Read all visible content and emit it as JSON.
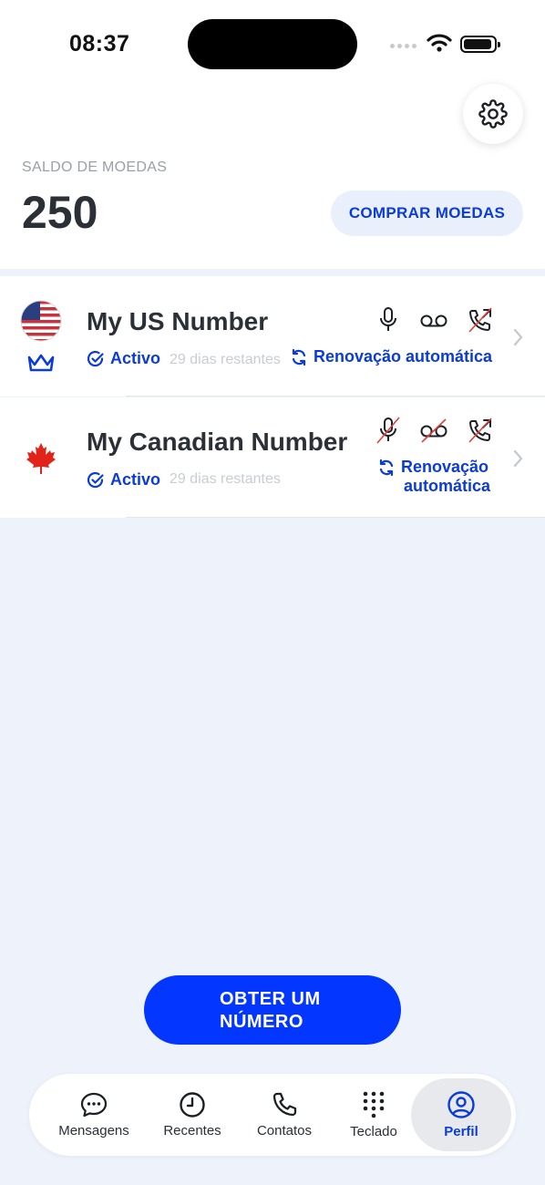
{
  "status": {
    "time": "08:37"
  },
  "balance": {
    "label": "SALDO DE MOEDAS",
    "value": "250",
    "buy_label": "COMPRAR MOEDAS"
  },
  "numbers": [
    {
      "name": "My US Number",
      "status": "Activo",
      "days": "29 dias restantes",
      "renewal": "Renovação automática",
      "flag": "us-flag",
      "premium_icon": "crown-icon",
      "features": {
        "voice": true,
        "voicemail": true,
        "forwarding": false
      }
    },
    {
      "name": "My Canadian Number",
      "status": "Activo",
      "days": "29 dias restantes",
      "renewal_line1": "Renovação",
      "renewal_line2": "automática",
      "flag": "canada-flag",
      "features": {
        "voice": false,
        "voicemail": false,
        "forwarding": false
      }
    }
  ],
  "get_number": {
    "line1": "OBTER UM",
    "line2": "NÚMERO"
  },
  "tabs": [
    {
      "label": "Mensagens",
      "icon": "chat-bubble-icon"
    },
    {
      "label": "Recentes",
      "icon": "clock-icon"
    },
    {
      "label": "Contatos",
      "icon": "phone-icon"
    },
    {
      "label": "Teclado",
      "icon": "keypad-icon"
    },
    {
      "label": "Perfil",
      "icon": "profile-icon",
      "active": true
    }
  ],
  "colors": {
    "accent": "#0336ff",
    "link": "#0b3bd8",
    "background": "#eef3fb",
    "disabled_slash": "#e0413a"
  }
}
